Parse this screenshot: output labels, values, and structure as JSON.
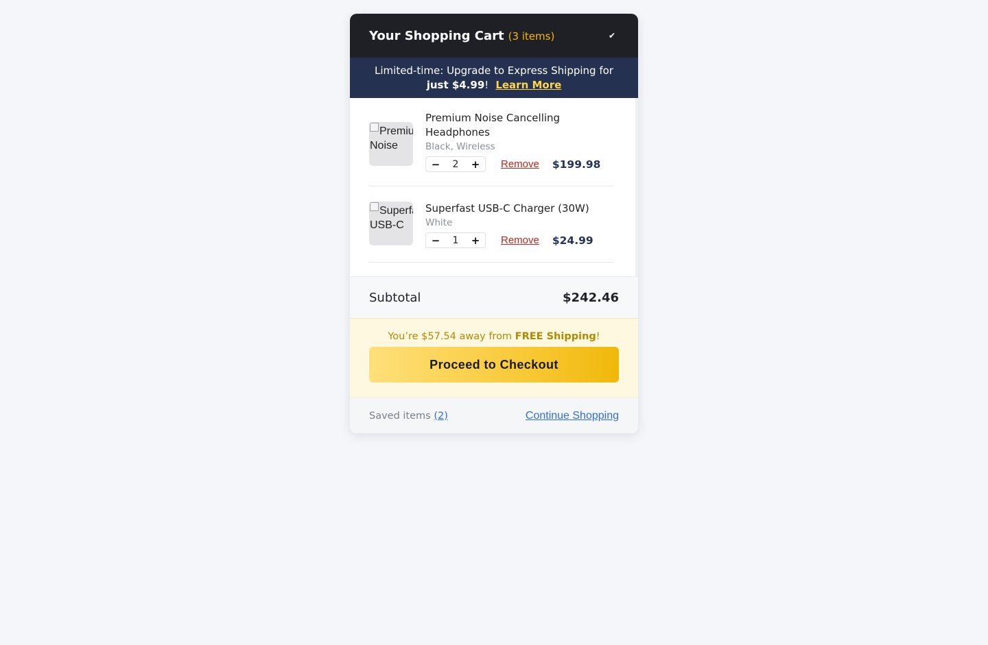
{
  "header": {
    "title": "Your Shopping Cart",
    "count": "(3 items)",
    "collapse_icon": "checkmark-icon",
    "collapse_glyph": "✔"
  },
  "promo": {
    "text": "Limited-time: Upgrade to Express Shipping for ",
    "bold": "just $4.99",
    "after": "!",
    "link": "Learn More"
  },
  "items": [
    {
      "name": "Premium Noise Cancelling Headphones",
      "variant": "Black, Wireless",
      "image_alt_line1": "Premium",
      "image_alt_line2": "Noise",
      "qty": "2",
      "remove": "Remove",
      "price": "$199.98"
    },
    {
      "name": "Superfast USB-C Charger (30W)",
      "variant": "White",
      "image_alt_line1": "Superfast",
      "image_alt_line2": "USB-C",
      "qty": "1",
      "remove": "Remove",
      "price": "$24.99"
    }
  ],
  "qty_controls": {
    "minus": "−",
    "plus": "+"
  },
  "summary": {
    "subtotal_label": "Subtotal",
    "subtotal_value": "$242.46"
  },
  "shipping": {
    "prefix": "You’re $57.54 away from ",
    "bold": "FREE Shipping",
    "suffix": "!"
  },
  "checkout_label": "Proceed to Checkout",
  "footer": {
    "saved_label": "Saved items ",
    "saved_count": "(2)",
    "continue_label": "Continue Shopping"
  },
  "colors": {
    "header_bg": "#1f2026",
    "accent_yellow": "#f5b800",
    "promo_bg": "#243150",
    "remove_red": "#c0261b",
    "link_blue": "#2f6fdb"
  }
}
